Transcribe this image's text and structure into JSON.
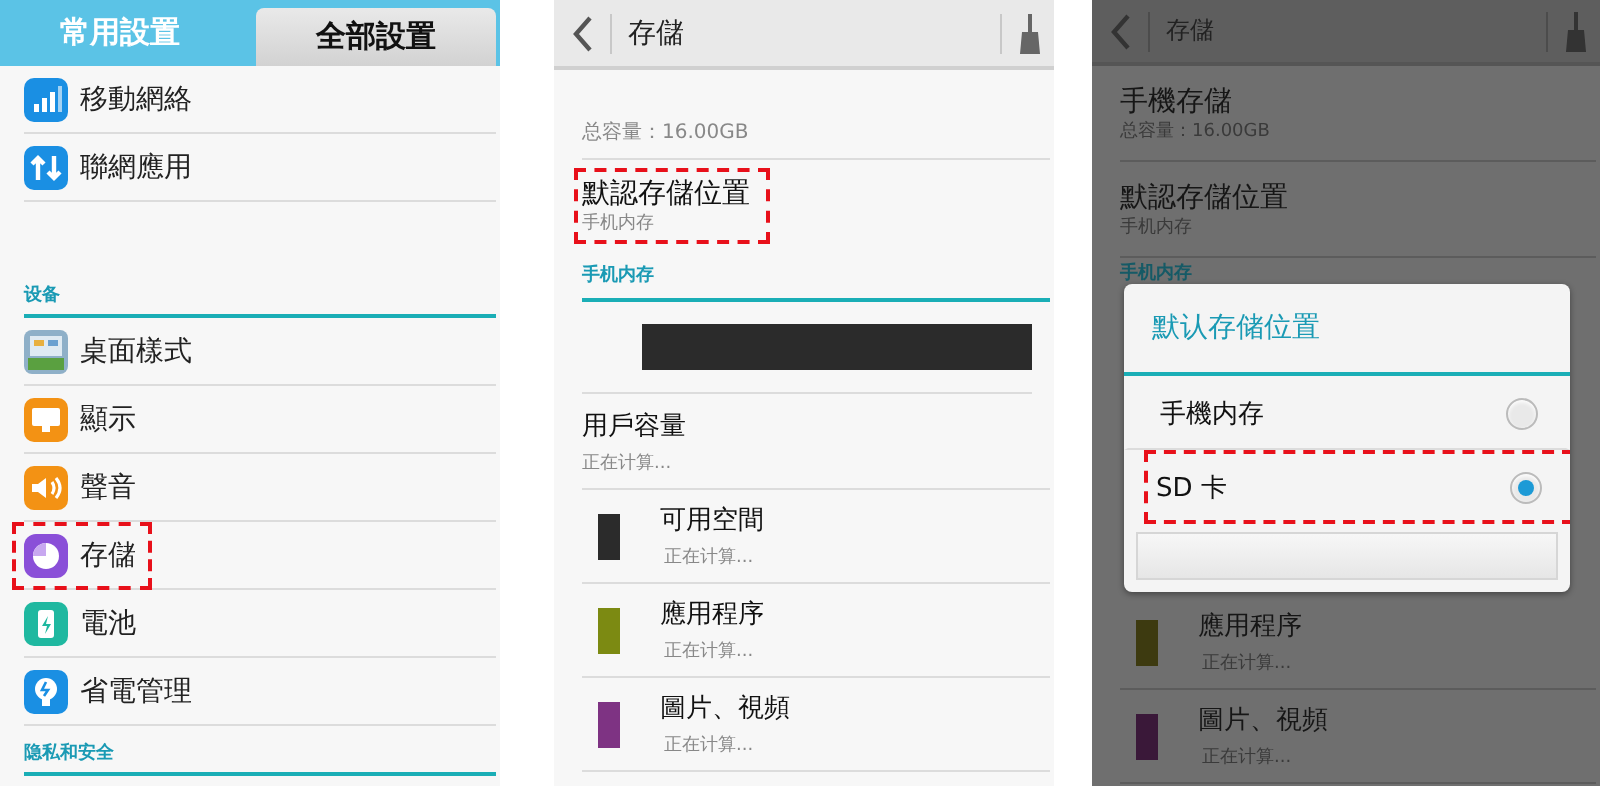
{
  "settings_screen": {
    "tabs": [
      {
        "label": "常用設置",
        "selected": true
      },
      {
        "label": "全部設置",
        "selected": false
      }
    ],
    "groups": [
      {
        "items": [
          {
            "label": "移動網絡",
            "highlighted": false
          },
          {
            "label": "聯網應用",
            "highlighted": false
          }
        ]
      },
      {
        "title": "设备",
        "items": [
          {
            "label": "桌面樣式",
            "highlighted": false
          },
          {
            "label": "顯示",
            "highlighted": false
          },
          {
            "label": "聲音",
            "highlighted": false
          },
          {
            "label": "存儲",
            "highlighted": true
          },
          {
            "label": "電池",
            "highlighted": false
          },
          {
            "label": "省電管理",
            "highlighted": false
          }
        ]
      },
      {
        "title": "隐私和安全"
      }
    ]
  },
  "storage_screen": {
    "title": "存儲",
    "total": "总容量：16.00GB",
    "default_location": {
      "title": "默認存儲位置",
      "subtitle": "手机内存",
      "highlighted": true
    },
    "section": "手机内存",
    "user_capacity": {
      "title": "用戶容量",
      "subtitle": "正在计算..."
    },
    "categories": [
      {
        "title": "可用空間",
        "subtitle": "正在计算...",
        "color": "#2b2b2b"
      },
      {
        "title": "應用程序",
        "subtitle": "正在计算...",
        "color": "#7c8a12"
      },
      {
        "title": "圖片、視頻",
        "subtitle": "正在计算...",
        "color": "#7e3383"
      }
    ]
  },
  "dialog_screen": {
    "title": "存儲",
    "rows": [
      {
        "title": "手機存儲",
        "subtitle": "总容量：16.00GB"
      },
      {
        "title": "默認存儲位置",
        "subtitle": "手机内存"
      }
    ],
    "section": "手机内存",
    "categories": [
      {
        "title": "應用程序",
        "subtitle": "正在计算...",
        "color": "#3d3a10"
      },
      {
        "title": "圖片、視頻",
        "subtitle": "正在计算...",
        "color": "#3a1839"
      }
    ],
    "dialog": {
      "title": "默认存储位置",
      "options": [
        {
          "label": "手機内存",
          "selected": false,
          "highlighted": false
        },
        {
          "label": "SD 卡",
          "selected": true,
          "highlighted": true
        }
      ]
    }
  }
}
